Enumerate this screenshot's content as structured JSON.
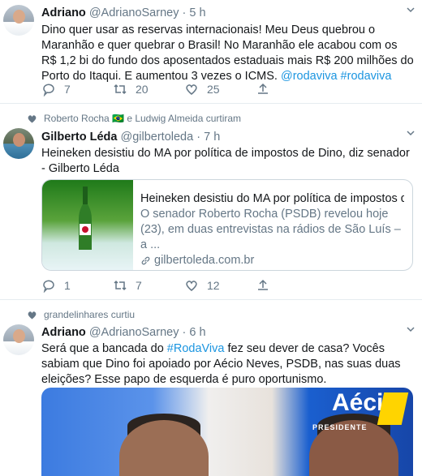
{
  "tweets": [
    {
      "name": "Adriano",
      "handle": "@AdrianoSarney",
      "sep": "·",
      "time": "5 h",
      "text": "Dino quer usar as reservas internacionais! Meu Deus quebrou o Maranhão e quer quebrar o Brasil! No Maranhão ele acabou com os R$ 1,2 bi do fundo dos aposentados estaduais mais R$ 200 milhões do Porto do Itaqui. E aumentou 3 vezes o ICMS. ",
      "mentions": "@rodaviva #rodaviva",
      "replies": "7",
      "retweets": "20",
      "likes": "25"
    },
    {
      "social_context": "Roberto Rocha 🇧🇷 e Ludwig Almeida curtiram",
      "name": "Gilberto Léda",
      "handle": "@gilbertoleda",
      "sep": "·",
      "time": "7 h",
      "text": "Heineken desistiu do MA por política de impostos de Dino, diz senador - Gilberto Léda",
      "card": {
        "title": "Heineken desistiu do MA por política de impostos d...",
        "description": "O senador Roberto Rocha (PSDB) revelou hoje (23), em duas entrevistas na rádios de São Luís – a ...",
        "url": "gilbertoleda.com.br"
      },
      "replies": "1",
      "retweets": "7",
      "likes": "12"
    },
    {
      "social_context": "grandelinhares curtiu",
      "name": "Adriano",
      "handle": "@AdrianoSarney",
      "sep": "·",
      "time": "6 h",
      "text_before": "Será que a bancada do ",
      "hashtag": "#RodaViva",
      "text_after": " fez seu dever de casa? Vocês sabiam que Dino foi apoiado por Aécio Neves, PSDB, nas suas duas eleições? Esse papo de esquerda é puro oportunismo.",
      "media_text": {
        "poster_big": "Aécio",
        "poster_small": "PRESIDENTE"
      }
    }
  ],
  "icons": [
    "reply-icon",
    "retweet-icon",
    "like-icon",
    "share-icon",
    "chevron-down-icon",
    "heart-icon",
    "link-icon"
  ],
  "colors": {
    "link": "#1b95e0",
    "muted": "#657786",
    "text": "#14171a",
    "border": "#e6ecf0"
  }
}
